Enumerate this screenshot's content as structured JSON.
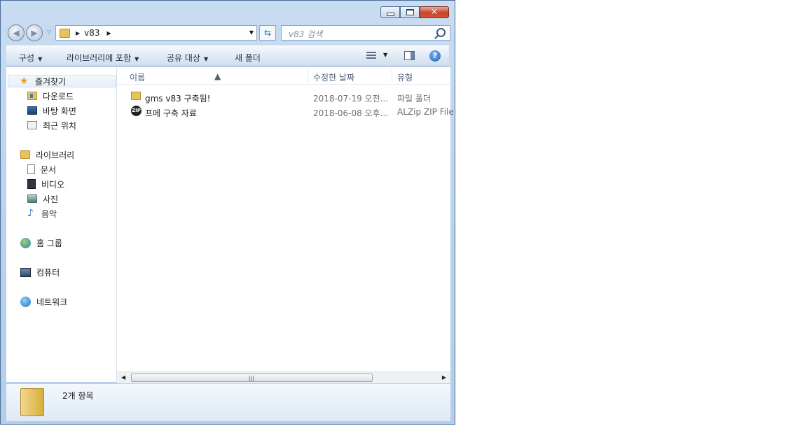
{
  "window": {
    "caption_buttons": [
      "minimize",
      "maximize",
      "close"
    ]
  },
  "address": {
    "crumb": "v83",
    "search_placeholder": "v83 검색"
  },
  "toolbar": {
    "organize": "구성",
    "include_in_library": "라이브러리에 포함",
    "share_with": "공유 대상",
    "new_folder": "새 폴더"
  },
  "nav": {
    "favorites": "즐겨찾기",
    "downloads": "다운로드",
    "desktop": "바탕 화면",
    "recent": "최근 위치",
    "libraries": "라이브러리",
    "documents": "문서",
    "videos": "비디오",
    "pictures": "사진",
    "music": "음악",
    "homegroup": "홈 그룹",
    "computer": "컴퓨터",
    "network": "네트워크"
  },
  "columns": {
    "name": "이름",
    "date": "수정한 날짜",
    "type": "유형"
  },
  "files": [
    {
      "name": "gms v83 구축됨!",
      "date": "2018-07-19 오전...",
      "type": "파일 폴더",
      "icon": "folder-icon"
    },
    {
      "name": "프메 구축 자료",
      "date": "2018-06-08 오후...",
      "type": "ALZip ZIP File",
      "icon": "zip-icon",
      "icon_text": "ZIP"
    }
  ],
  "status": {
    "count": "2개 항목"
  }
}
